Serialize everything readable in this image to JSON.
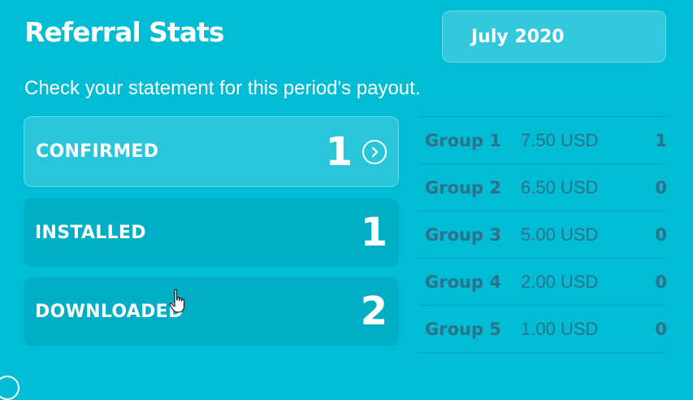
{
  "header": {
    "title": "Referral Stats",
    "period": "July 2020",
    "subtitle": "Check your statement for this period's payout."
  },
  "stats": [
    {
      "label": "CONFIRMED",
      "value": "1"
    },
    {
      "label": "INSTALLED",
      "value": "1"
    },
    {
      "label": "DOWNLOADED",
      "value": "2"
    }
  ],
  "groups": [
    {
      "name": "Group 1",
      "amount": "7.50 USD",
      "count": "1"
    },
    {
      "name": "Group 2",
      "amount": "6.50 USD",
      "count": "0"
    },
    {
      "name": "Group 3",
      "amount": "5.00 USD",
      "count": "0"
    },
    {
      "name": "Group 4",
      "amount": "2.00 USD",
      "count": "0"
    },
    {
      "name": "Group 5",
      "amount": "1.00 USD",
      "count": "0"
    }
  ],
  "icons": {
    "details": "chevron-right-circle-icon",
    "pointer": "hand-pointer-icon"
  },
  "colors": {
    "background": "#00bcd4",
    "group_text": "#2e7289",
    "muted_card": "#00afc6"
  }
}
